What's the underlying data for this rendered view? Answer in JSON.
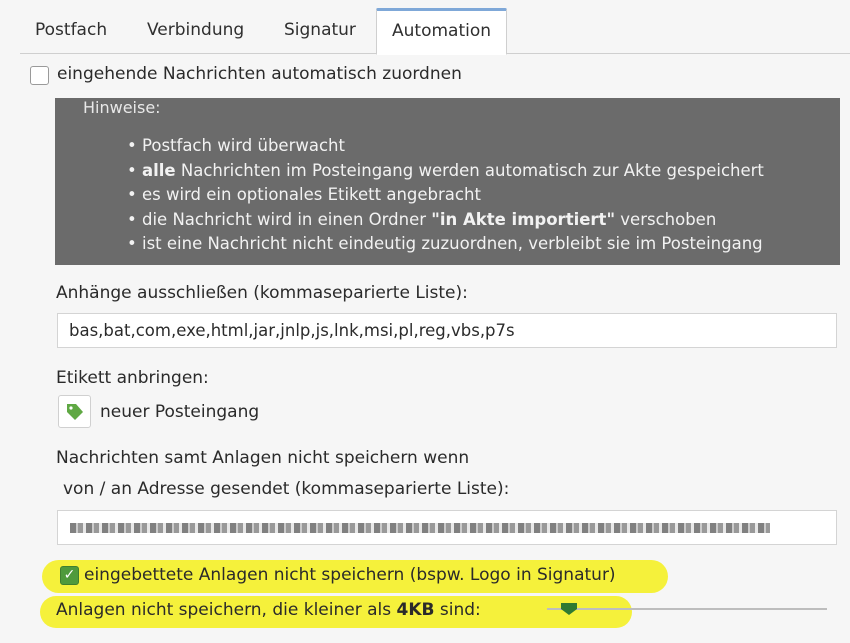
{
  "tabs": [
    {
      "label": "Postfach",
      "active": false
    },
    {
      "label": "Verbindung",
      "active": false
    },
    {
      "label": "Signatur",
      "active": false
    },
    {
      "label": "Automation",
      "active": true
    }
  ],
  "auto_assign": {
    "label": "eingehende Nachrichten automatisch zuordnen",
    "checked": false
  },
  "hints": {
    "title": "Hinweise:",
    "items": [
      {
        "bold": "",
        "text": "Postfach wird überwacht",
        "bold_mid": "",
        "tail": ""
      },
      {
        "bold": "alle",
        "text": " Nachrichten im Posteingang werden automatisch zur Akte gespeichert",
        "bold_mid": "",
        "tail": ""
      },
      {
        "bold": "",
        "text": "es wird ein optionales Etikett angebracht",
        "bold_mid": "",
        "tail": ""
      },
      {
        "bold": "",
        "text": "die Nachricht wird in einen Ordner ",
        "bold_mid": "\"in Akte importiert\"",
        "tail": " verschoben"
      },
      {
        "bold": "",
        "text": "ist eine Nachricht nicht eindeutig zuzuordnen, verbleibt sie im Posteingang",
        "bold_mid": "",
        "tail": ""
      }
    ],
    "bullet": "•"
  },
  "exclude": {
    "label": "Anhänge ausschließen (kommaseparierte Liste):",
    "value": "bas,bat,com,exe,html,jar,jnlp,js,lnk,msi,pl,reg,vbs,p7s"
  },
  "tag": {
    "label": "Etikett anbringen:",
    "value": "neuer Posteingang",
    "color": "#5fa843"
  },
  "nosave": {
    "label_line1": "Nachrichten samt Anlagen nicht speichern wenn",
    "label_line2": "von / an Adresse gesendet (kommaseparierte Liste):"
  },
  "embedded": {
    "label": "eingebettete Anlagen nicht speichern (bspw. Logo in Signatur)",
    "checked": true,
    "check_glyph": "✓"
  },
  "minsize": {
    "prefix": "Anlagen nicht speichern, die kleiner als ",
    "value": "4KB",
    "suffix": " sind:",
    "slider_fraction": 0.08
  },
  "colors": {
    "accent": "#7fa8d8",
    "highlight": "#f5f13b",
    "hint_bg": "#6b6b6b",
    "check": "#4f9a3c",
    "warning": "#d63a2e"
  }
}
